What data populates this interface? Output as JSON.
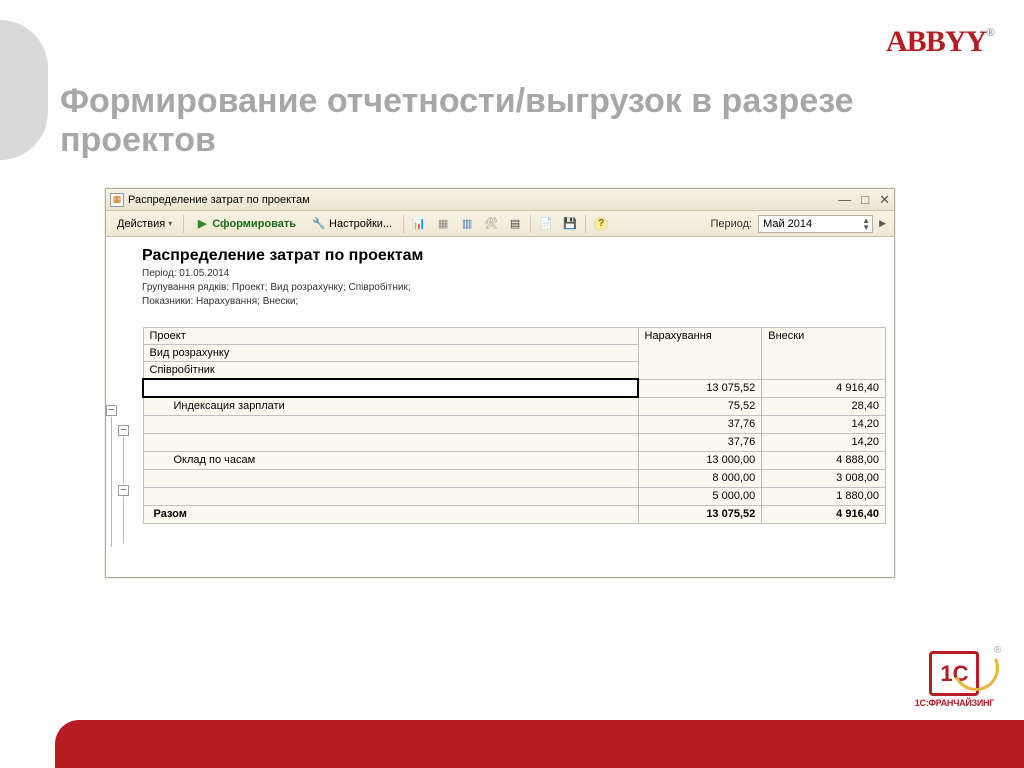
{
  "slide_title": "Формирование отчетности/выгрузок в разрезе проектов",
  "abbyy": "ABBYY",
  "onec_text": "1С",
  "onec_sub": "1С:ФРАНЧАЙЗИНГ",
  "window": {
    "title": "Распределение затрат по проектам",
    "toolbar": {
      "actions": "Действия",
      "form": "Сформировать",
      "settings": "Настройки...",
      "period_label": "Период:",
      "period_value": "Май 2014"
    },
    "report": {
      "title": "Распределение затрат по проектам",
      "meta1": "Період: 01.05.2014",
      "meta2": "Групування рядків: Проект; Вид розрахунку; Співробітник;",
      "meta3": "Показники: Нарахування; Внески;",
      "headers": {
        "c1": "Проект",
        "c1b": "Вид розрахунку",
        "c1c": "Співробітник",
        "c2": "Нарахування",
        "c3": "Внески"
      },
      "rows": [
        {
          "name": "",
          "nar": "13 075,52",
          "vn": "4 916,40",
          "sel": true,
          "indent": 0
        },
        {
          "name": "Индексация зарплати",
          "nar": "75,52",
          "vn": "28,40",
          "indent": 1
        },
        {
          "name": "",
          "nar": "37,76",
          "vn": "14,20",
          "indent": 1
        },
        {
          "name": "",
          "nar": "37,76",
          "vn": "14,20",
          "indent": 1
        },
        {
          "name": "Оклад по часам",
          "nar": "13 000,00",
          "vn": "4 888,00",
          "indent": 1
        },
        {
          "name": "",
          "nar": "8 000,00",
          "vn": "3 008,00",
          "indent": 1
        },
        {
          "name": "",
          "nar": "5 000,00",
          "vn": "1 880,00",
          "indent": 1
        }
      ],
      "total": {
        "name": "Разом",
        "nar": "13 075,52",
        "vn": "4 916,40"
      }
    }
  }
}
